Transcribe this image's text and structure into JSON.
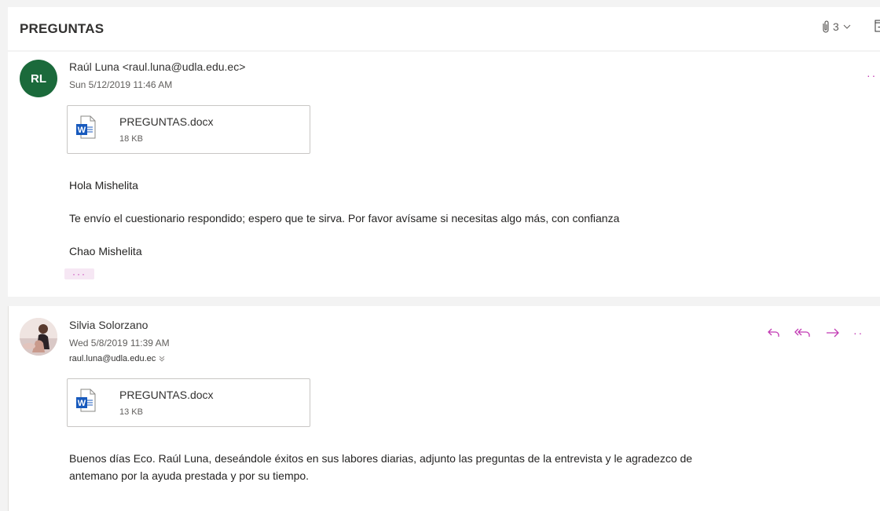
{
  "conversation": {
    "subject": "PREGUNTAS",
    "attachment_count": "3"
  },
  "messages": [
    {
      "avatar_initials": "RL",
      "sender": "Raúl Luna <raul.luna@udla.edu.ec>",
      "date": "Sun 5/12/2019 11:46 AM",
      "attachment": {
        "name": "PREGUNTAS.docx",
        "size": "18 KB"
      },
      "body": [
        "Hola Mishelita",
        "Te envío el cuestionario respondido; espero que te sirva. Por favor avísame si necesitas algo más, con confianza",
        "Chao Mishelita"
      ],
      "ellipsis": "···"
    },
    {
      "sender": "Silvia Solorzano",
      "date": "Wed 5/8/2019 11:39 AM",
      "to": "raul.luna@udla.edu.ec",
      "attachment": {
        "name": "PREGUNTAS.docx",
        "size": "13 KB"
      },
      "body": [
        "Buenos días Eco. Raúl Luna, deseándole éxitos en sus labores diarias, adjunto las preguntas de la entrevista y le agradezco de",
        "antemano por la ayuda prestada y por su tiempo."
      ]
    }
  ],
  "more_menu": "··",
  "colors": {
    "accent": "#c239b3",
    "avatar_rl": "#1b6a3b",
    "word_blue": "#185abd"
  },
  "icons": [
    "paperclip-icon",
    "chevron-down-icon",
    "expand-icon",
    "word-doc-icon",
    "reply-icon",
    "reply-all-icon",
    "forward-icon",
    "more-icon"
  ]
}
